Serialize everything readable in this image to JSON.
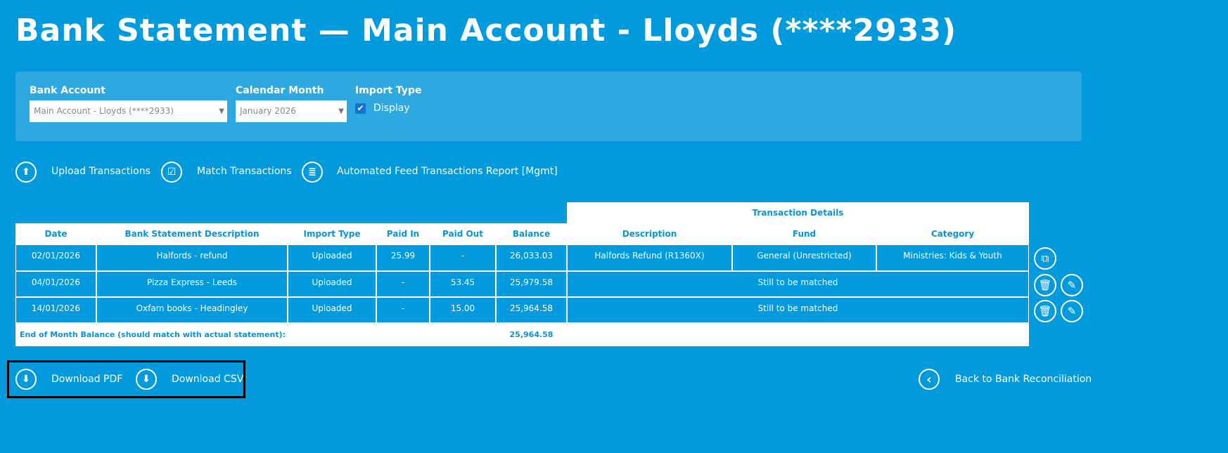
{
  "title": "Bank Statement — Main Account - Lloyds (****2933)",
  "filters": {
    "bank_account_label": "Bank Account",
    "bank_account_value": "Main Account - Lloyds (****2933)",
    "month_label": "Calendar Month",
    "month_value": "January 2026",
    "import_type_label": "Import Type",
    "display_label": "Display",
    "display_checked": true
  },
  "actions": {
    "upload": "Upload Transactions",
    "match": "Match Transactions",
    "report": "Automated Feed Transactions Report [Mgmt]"
  },
  "table": {
    "group_header": "Transaction Details",
    "headers": [
      "Date",
      "Bank Statement Description",
      "Import Type",
      "Paid In",
      "Paid Out",
      "Balance",
      "Description",
      "Fund",
      "Category"
    ],
    "rows": [
      {
        "date": "02/01/2026",
        "desc": "Halfords - refund",
        "type": "Uploaded",
        "in": "25.99",
        "out": "-",
        "bal": "26,033.03",
        "tdesc": "Halfords Refund (R1360X)",
        "fund": "General (Unrestricted)",
        "cat": "Ministries: Kids & Youth"
      },
      {
        "date": "04/01/2026",
        "desc": "Pizza Express - Leeds",
        "type": "Uploaded",
        "in": "-",
        "out": "53.45",
        "bal": "25,979.58",
        "status": "Still to be matched"
      },
      {
        "date": "14/01/2026",
        "desc": "Oxfam books - Headingley",
        "type": "Uploaded",
        "in": "-",
        "out": "15.00",
        "bal": "25,964.58",
        "status": "Still to be matched"
      }
    ],
    "footer_label": "End of Month Balance (should match with actual statement):",
    "footer_balance": "25,964.58"
  },
  "downloads": {
    "pdf": "Download PDF",
    "csv": "Download CSV"
  },
  "back": "Back to Bank Reconciliation"
}
